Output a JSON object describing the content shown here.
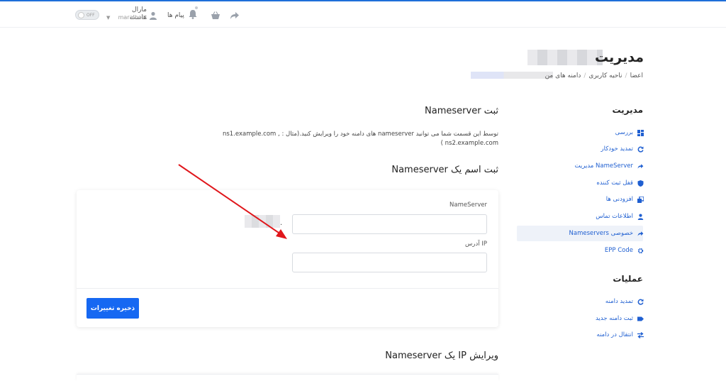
{
  "topbar": {
    "toggle_label": "OFF",
    "user_name": "مارال هاست",
    "user_sub": "maralhost",
    "messages_label": "پیام ها"
  },
  "header": {
    "title": "مدیریت",
    "breadcrumb": [
      "اعضا",
      "ناحیه کاربری",
      "دامنه های من"
    ]
  },
  "sidebar": {
    "manage_heading": "مدیریت",
    "manage_items": [
      {
        "label": "بررسی",
        "icon": "dashboard-icon"
      },
      {
        "label": "تمدید خودکار",
        "icon": "refresh-icon"
      },
      {
        "label": "مدیریت NameServer",
        "icon": "share-icon"
      },
      {
        "label": "قفل ثبت کننده",
        "icon": "shield-icon"
      },
      {
        "label": "افزودنی ها",
        "icon": "addons-icon"
      },
      {
        "label": "اطلاعات تماس",
        "icon": "user-icon"
      },
      {
        "label": "Nameservers خصوصی",
        "icon": "share-icon"
      },
      {
        "label": "EPP Code",
        "icon": "gear-icon"
      }
    ],
    "ops_heading": "عملیات",
    "ops_items": [
      {
        "label": "تمدید دامنه",
        "icon": "refresh-icon"
      },
      {
        "label": "ثبت دامنه جدید",
        "icon": "tag-icon"
      },
      {
        "label": "انتقال در دامنه",
        "icon": "transfer-icon"
      }
    ]
  },
  "main": {
    "register_title": "ثبت Nameserver",
    "description": "توسط این قسمت شما می توانید nameserver های دامنه خود را ویرایش کنید.(مثال : ns1.example.com , ns2.example.com )",
    "register_one_title": "ثبت اسم یک Nameserver",
    "form": {
      "nameserver_label": "NameServer",
      "nameserver_value": "",
      "suffix": ".",
      "ip_label": "آدرس IP",
      "ip_value": "",
      "save_label": "ذخیره تغییرات"
    },
    "edit_ip_title": "ویرایش IP یک Nameserver"
  },
  "colors": {
    "accent": "#1668f2",
    "link": "#1f5fd1",
    "arrow": "#e0161b"
  }
}
